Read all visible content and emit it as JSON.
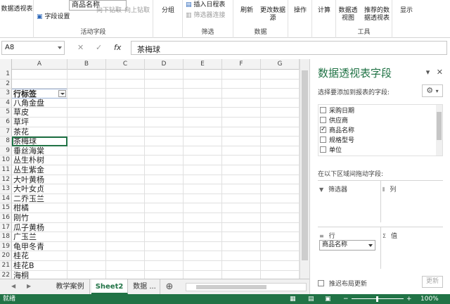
{
  "ribbon": {
    "partial_left_label": "数据透视表",
    "field_name_input": "商品名称",
    "field_settings": "字段设置",
    "drill_down": "向下钻取",
    "drill_up": "向上钻取",
    "active_field_label": "活动字段",
    "group": "分组",
    "insert_timeline": "插入日程表",
    "filter_connections": "筛选器连接",
    "filter_group_label": "筛选",
    "refresh": "刷新",
    "change_source": "更改数据源",
    "data_group_label": "数据",
    "actions": "操作",
    "calculate": "计算",
    "pivot_chart": "数据透视图",
    "recommended": "推荐的数据透视表",
    "tools_group_label": "工具",
    "show": "显示"
  },
  "formula_bar": {
    "name_box": "A8",
    "cancel_icon": "✕",
    "enter_icon": "✓",
    "fx": "fx",
    "value": "茶梅球"
  },
  "columns": [
    "A",
    "B",
    "C",
    "D",
    "E",
    "F",
    "G"
  ],
  "rows": [
    {
      "n": "1",
      "a": ""
    },
    {
      "n": "2",
      "a": ""
    },
    {
      "n": "3",
      "a": "行标签"
    },
    {
      "n": "4",
      "a": "八角金盘"
    },
    {
      "n": "5",
      "a": "草皮"
    },
    {
      "n": "6",
      "a": "草坪"
    },
    {
      "n": "7",
      "a": "茶花"
    },
    {
      "n": "8",
      "a": "茶梅球"
    },
    {
      "n": "9",
      "a": "垂丝海棠"
    },
    {
      "n": "10",
      "a": "丛生朴树"
    },
    {
      "n": "11",
      "a": "丛生紫金"
    },
    {
      "n": "12",
      "a": "大叶黄杨"
    },
    {
      "n": "13",
      "a": "大叶女贞"
    },
    {
      "n": "14",
      "a": "二乔玉兰"
    },
    {
      "n": "15",
      "a": "柑橘"
    },
    {
      "n": "16",
      "a": "刚竹"
    },
    {
      "n": "17",
      "a": "瓜子黄杨"
    },
    {
      "n": "18",
      "a": "广玉兰"
    },
    {
      "n": "19",
      "a": "龟甲冬青"
    },
    {
      "n": "20",
      "a": "桂花"
    },
    {
      "n": "21",
      "a": "桂花B"
    },
    {
      "n": "22",
      "a": "海桐"
    }
  ],
  "sheet_tabs": {
    "tab1": "教学案例",
    "tab2": "Sheet2",
    "tab3": "数据 ...",
    "add": "⊕"
  },
  "status": {
    "ready": "就绪",
    "zoom": "100%",
    "minus": "−",
    "plus": "+"
  },
  "pivot_pane": {
    "title": "数据透视表字段",
    "subtitle": "选择要添加到报表的字段:",
    "fields": [
      {
        "label": "采购日期",
        "checked": false
      },
      {
        "label": "供应商",
        "checked": false
      },
      {
        "label": "商品名称",
        "checked": true
      },
      {
        "label": "规格型号",
        "checked": false
      },
      {
        "label": "单位",
        "checked": false
      }
    ],
    "drag_hint": "在以下区域间拖动字段:",
    "area_filter": "筛选器",
    "area_columns": "列",
    "area_rows": "行",
    "area_values": "值",
    "row_chip": "商品名称",
    "defer_update": "推迟布局更新",
    "update_button": "更新"
  },
  "colors": {
    "excel_green": "#217346"
  }
}
